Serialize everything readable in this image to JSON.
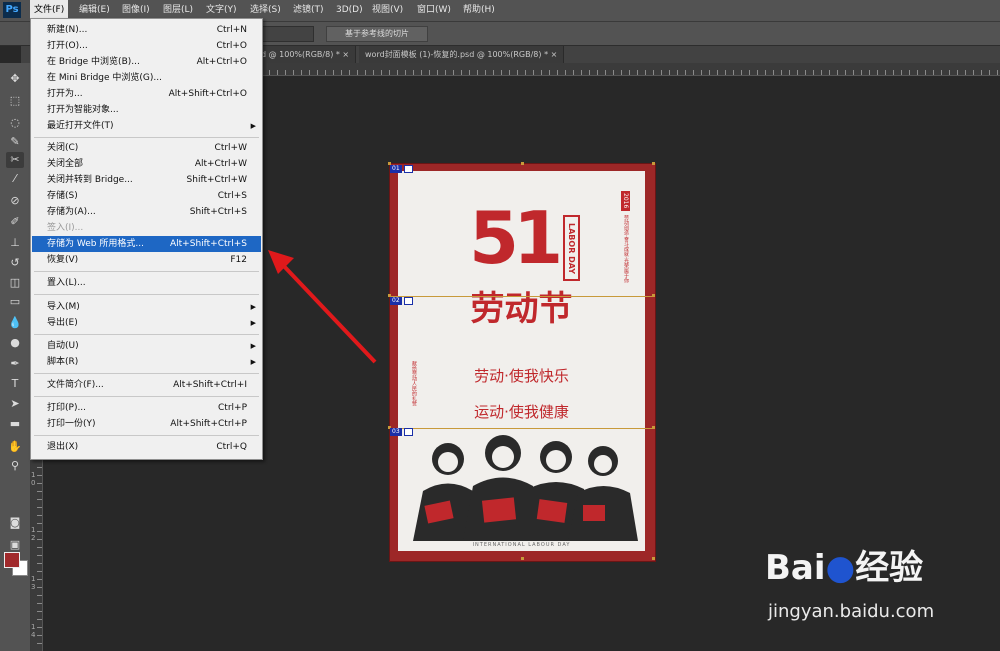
{
  "app": {
    "logo": "Ps"
  },
  "menubar": [
    {
      "label": "文件(F)"
    },
    {
      "label": "编辑(E)"
    },
    {
      "label": "图像(I)"
    },
    {
      "label": "图层(L)"
    },
    {
      "label": "文字(Y)"
    },
    {
      "label": "选择(S)"
    },
    {
      "label": "滤镜(T)"
    },
    {
      "label": "3D(D)"
    },
    {
      "label": "视图(V)"
    },
    {
      "label": "窗口(W)"
    },
    {
      "label": "帮助(H)"
    }
  ],
  "options_bar": {
    "button_label": "基于参考线的切片"
  },
  "tabs": [
    {
      "label": "d @ 100%(RGB/8) * ×"
    },
    {
      "label": "word封面模板 (1)-恢复的.psd @ 100%(RGB/8) * ×"
    }
  ],
  "ruler_left_numbers": [
    "1",
    "0",
    "1",
    "2",
    "1",
    "3",
    "1",
    "4",
    "1",
    "5"
  ],
  "file_menu": [
    {
      "label": "新建(N)...",
      "shortcut": "Ctrl+N"
    },
    {
      "label": "打开(O)...",
      "shortcut": "Ctrl+O"
    },
    {
      "label": "在 Bridge 中浏览(B)...",
      "shortcut": "Alt+Ctrl+O"
    },
    {
      "label": "在 Mini Bridge 中浏览(G)...",
      "shortcut": ""
    },
    {
      "label": "打开为...",
      "shortcut": "Alt+Shift+Ctrl+O"
    },
    {
      "label": "打开为智能对象...",
      "shortcut": ""
    },
    {
      "label": "最近打开文件(T)",
      "shortcut": "",
      "submenu": true
    },
    {
      "label": "关闭(C)",
      "shortcut": "Ctrl+W"
    },
    {
      "label": "关闭全部",
      "shortcut": "Alt+Ctrl+W"
    },
    {
      "label": "关闭并转到 Bridge...",
      "shortcut": "Shift+Ctrl+W"
    },
    {
      "label": "存储(S)",
      "shortcut": "Ctrl+S"
    },
    {
      "label": "存储为(A)...",
      "shortcut": "Shift+Ctrl+S"
    },
    {
      "label": "签入(I)...",
      "shortcut": "",
      "disabled": true
    },
    {
      "label": "存储为 Web 所用格式...",
      "shortcut": "Alt+Shift+Ctrl+S",
      "highlighted": true
    },
    {
      "label": "恢复(V)",
      "shortcut": "F12"
    },
    {
      "label": "置入(L)...",
      "shortcut": ""
    },
    {
      "label": "导入(M)",
      "shortcut": "",
      "submenu": true
    },
    {
      "label": "导出(E)",
      "shortcut": "",
      "submenu": true
    },
    {
      "label": "自动(U)",
      "shortcut": "",
      "submenu": true
    },
    {
      "label": "脚本(R)",
      "shortcut": "",
      "submenu": true
    },
    {
      "label": "文件简介(F)...",
      "shortcut": "Alt+Shift+Ctrl+I"
    },
    {
      "label": "打印(P)...",
      "shortcut": "Ctrl+P"
    },
    {
      "label": "打印一份(Y)",
      "shortcut": "Alt+Shift+Ctrl+P"
    },
    {
      "label": "退出(X)",
      "shortcut": "Ctrl+Q"
    }
  ],
  "poster": {
    "number": "51",
    "labor_day": "LABOR DAY",
    "year": "2016",
    "side_text": "劳动创造·奋斗成就·光荣属于你",
    "side_text_left": "献给劳动人民的礼赞",
    "title": "劳动节",
    "slogan1": "劳动·使我快乐",
    "slogan2": "运动·使我健康",
    "footer": "INTERNATIONAL LABOUR DAY"
  },
  "slices": [
    {
      "label": "01"
    },
    {
      "label": "02"
    },
    {
      "label": "03"
    }
  ],
  "watermark": {
    "logo_a": "Bai",
    "logo_b": "经验",
    "url": "jingyan.baidu.com"
  },
  "colors": {
    "accent_red": "#c0282c",
    "menu_highlight": "#1e67c4",
    "foreground_swatch": "#a12a2c"
  }
}
